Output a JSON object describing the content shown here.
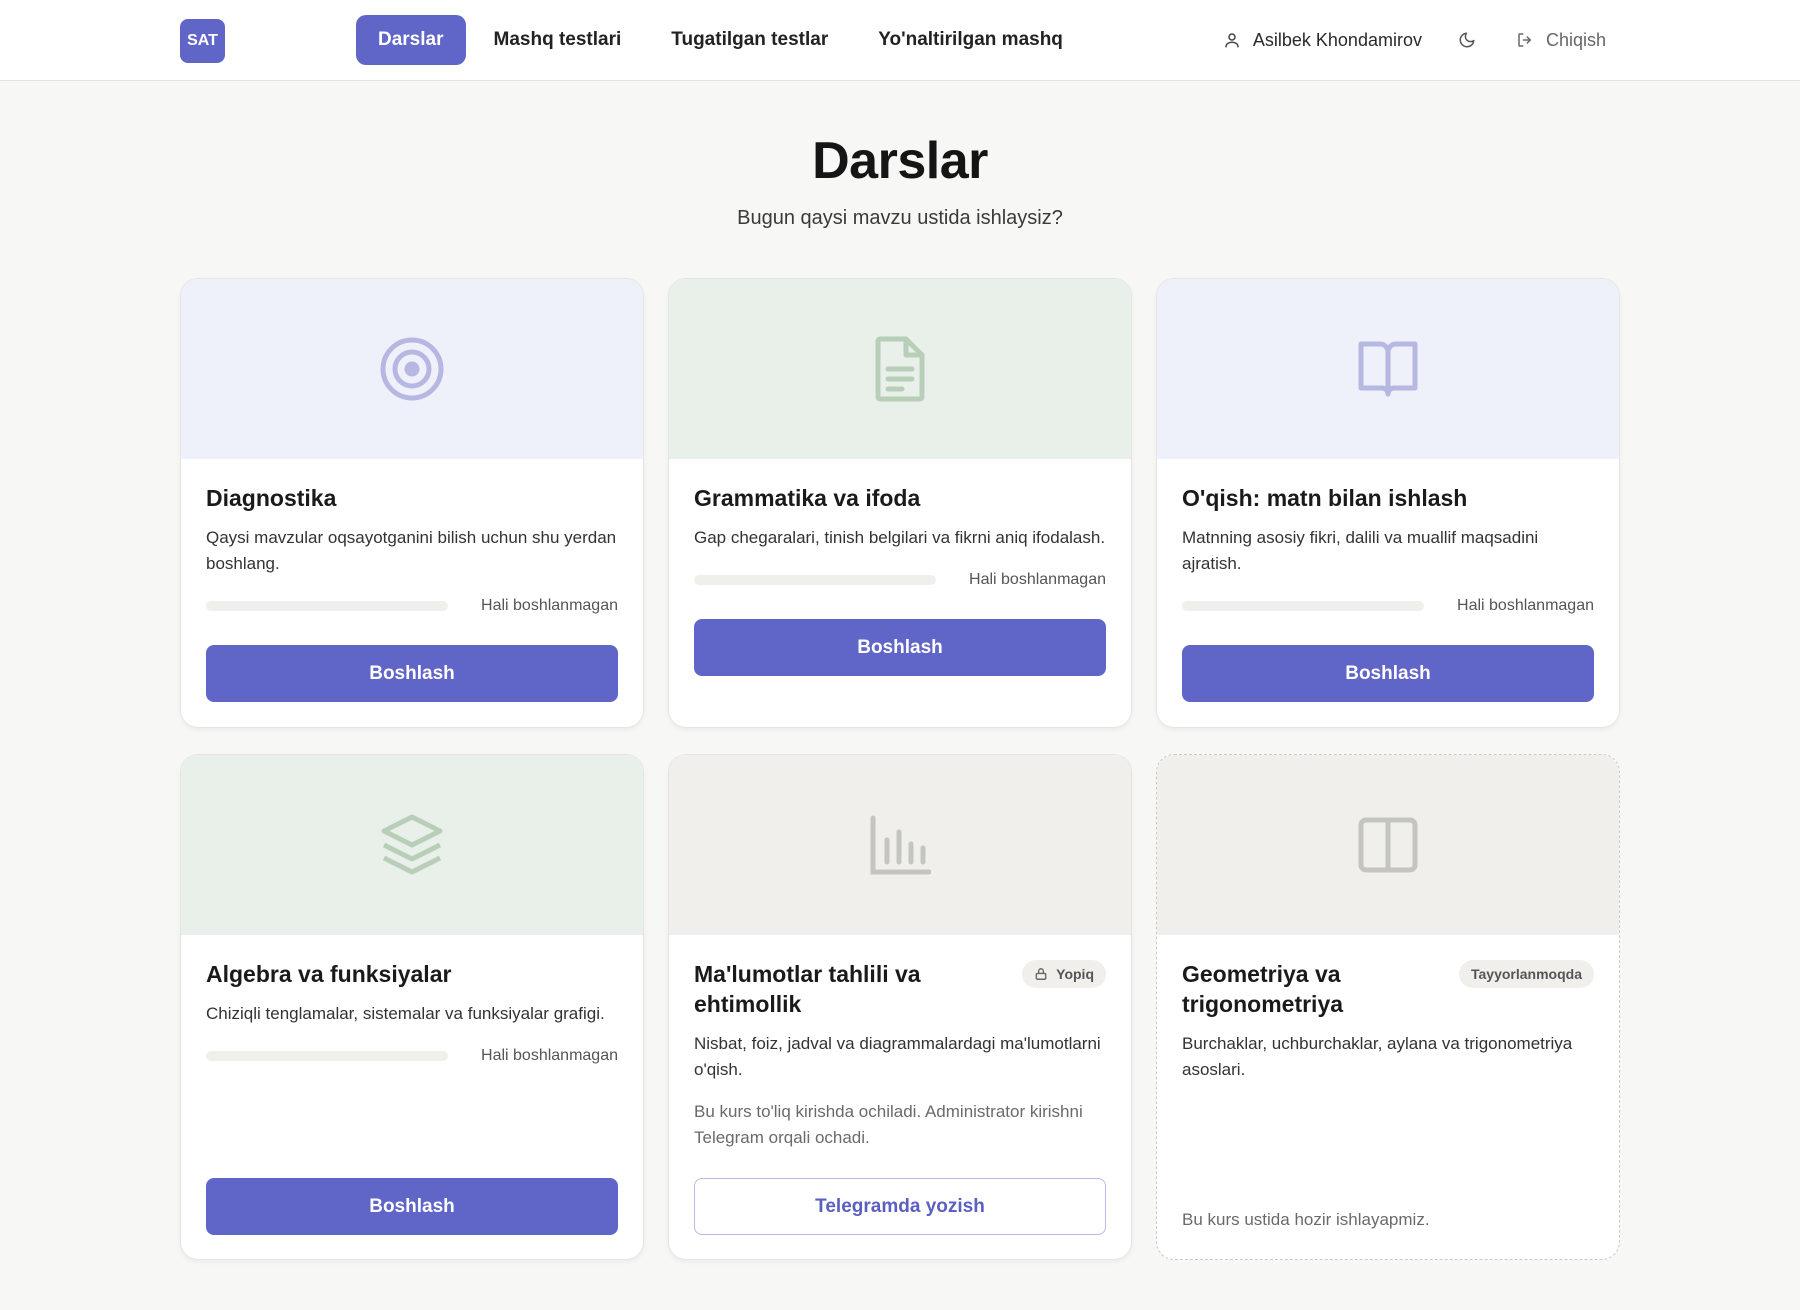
{
  "header": {
    "logo": "SAT",
    "nav": [
      {
        "label": "Darslar",
        "active": true
      },
      {
        "label": "Mashq testlari",
        "active": false
      },
      {
        "label": "Tugatilgan testlar",
        "active": false
      },
      {
        "label": "Yo'naltirilgan mashq",
        "active": false
      }
    ],
    "user_name": "Asilbek Khondamirov",
    "logout_label": "Chiqish"
  },
  "page": {
    "title": "Darslar",
    "subtitle": "Bugun qaysi mavzu ustida ishlaysiz?"
  },
  "cards": [
    {
      "title": "Diagnostika",
      "description": "Qaysi mavzular oqsayotganini bilish uchun shu yerdan boshlang.",
      "icon": "target-icon",
      "progress": 0,
      "progress_label": "Hali boshlanmagan",
      "button": "Boshlash",
      "color": "#b7b8e2"
    },
    {
      "title": "Grammatika va ifoda",
      "description": "Gap chegaralari, tinish belgilari va fikrni aniq ifodalash.",
      "icon": "document-icon",
      "progress": 0,
      "progress_label": "Hali boshlanmagan",
      "button": "Boshlash",
      "color": "#b9ceb9"
    },
    {
      "title": "O'qish: matn bilan ishlash",
      "description": "Matnning asosiy fikri, dalili va muallif maqsadini ajratish.",
      "icon": "book-open-icon",
      "progress": 0,
      "progress_label": "Hali boshlanmagan",
      "button": "Boshlash",
      "color": "#b7b8e2"
    },
    {
      "title": "Algebra va funksiyalar",
      "description": "Chiziqli tenglamalar, sistemalar va funksiyalar grafigi.",
      "icon": "layers-icon",
      "progress": 0,
      "progress_label": "Hali boshlanmagan",
      "button": "Boshlash",
      "color": "#b9ceb9"
    },
    {
      "title": "Ma'lumotlar tahlili va ehtimollik",
      "description": "Nisbat, foiz, jadval va diagrammalardagi ma'lumotlarni o'qish.",
      "icon": "bar-chart-icon",
      "badge": "Yopiq",
      "note": "Bu kurs to'liq kirishda ochiladi. Administrator kirishni Telegram orqali ochadi.",
      "button": "Telegramda yozish",
      "color": "#c4c4c0"
    },
    {
      "title": "Geometriya va trigonometriya",
      "description": "Burchaklar, uchburchaklar, aylana va trigonometriya asoslari.",
      "icon": "panel-icon",
      "badge": "Tayyorlanmoqda",
      "note": "Bu kurs ustida hozir ishlayapmiz.",
      "color": "#c4c4c0"
    }
  ]
}
